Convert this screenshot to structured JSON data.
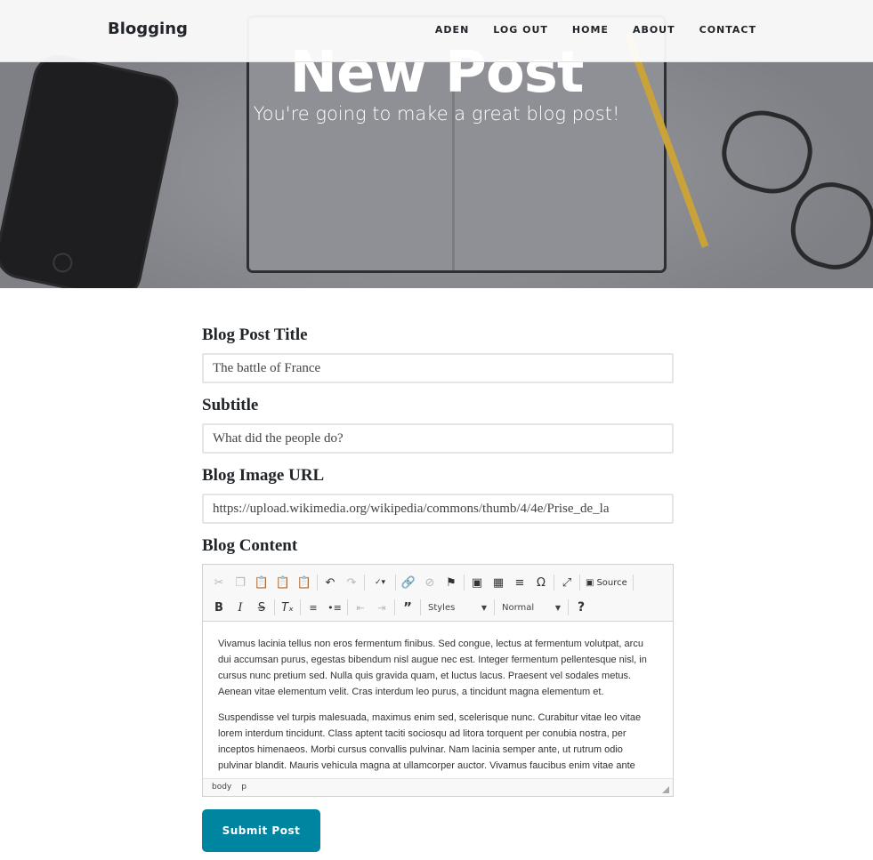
{
  "navbar": {
    "brand": "Blogging",
    "links": [
      "ADEN",
      "LOG OUT",
      "HOME",
      "ABOUT",
      "CONTACT"
    ]
  },
  "hero": {
    "title": "New Post",
    "subheading": "You're going to make a great blog post!"
  },
  "form": {
    "title_label": "Blog Post Title",
    "title_value": "The battle of France",
    "subtitle_label": "Subtitle",
    "subtitle_value": "What did the people do?",
    "image_label": "Blog Image URL",
    "image_value": "https://upload.wikimedia.org/wikipedia/commons/thumb/4/4e/Prise_de_la",
    "content_label": "Blog Content",
    "submit_label": "Submit Post"
  },
  "editor": {
    "toolbar_row1": [
      "cut-icon",
      "copy-icon",
      "paste-icon",
      "paste-text-icon",
      "paste-word-icon",
      "undo-icon",
      "redo-icon",
      "spellcheck-icon",
      "link-icon",
      "unlink-icon",
      "anchor-icon",
      "image-icon",
      "table-icon",
      "horizontal-rule-icon",
      "special-char-icon",
      "maximize-icon"
    ],
    "source_label": "Source",
    "styles_label": "Styles",
    "format_label": "Normal",
    "help_label": "?",
    "paragraphs": [
      "Vivamus lacinia tellus non eros fermentum finibus. Sed congue, lectus at fermentum volutpat, arcu dui accumsan purus, egestas bibendum nisl augue nec est. Integer fermentum pellentesque nisl, in cursus nunc pretium sed. Nulla quis gravida quam, et luctus lacus. Praesent vel sodales metus. Aenean vitae elementum velit. Cras interdum leo purus, a tincidunt magna elementum et.",
      "Suspendisse vel turpis malesuada, maximus enim sed, scelerisque nunc. Curabitur vitae leo vitae lorem interdum tincidunt. Class aptent taciti sociosqu ad litora torquent per conubia nostra, per inceptos himenaeos. Morbi cursus convallis pulvinar. Nam lacinia semper ante, ut rutrum odio pulvinar blandit. Mauris vehicula magna at ullamcorper auctor. Vivamus faucibus enim vitae ante"
    ],
    "path": [
      "body",
      "p"
    ]
  },
  "colors": {
    "accent": "#0085a1",
    "text": "#212529"
  }
}
